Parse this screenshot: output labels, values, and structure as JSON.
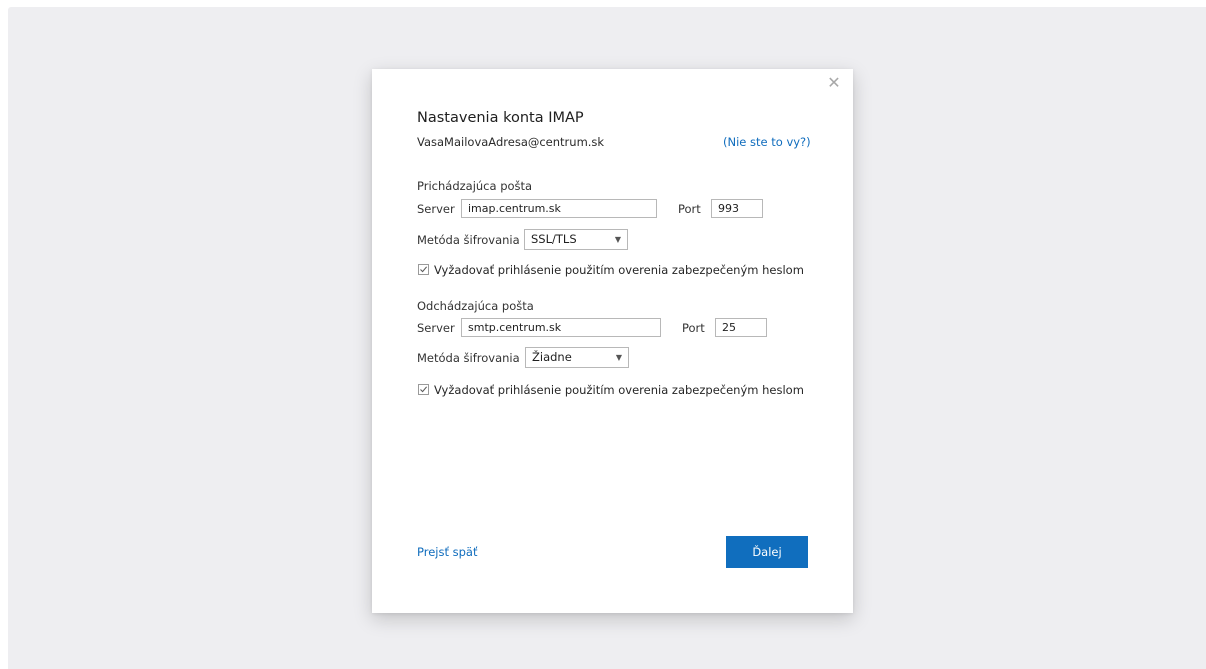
{
  "dialog": {
    "title": "Nastavenia konta IMAP",
    "email": "VasaMailovaAdresa@centrum.sk",
    "not_you_link": "(Nie ste to vy?)",
    "close_glyph": "✕"
  },
  "incoming": {
    "section_label": "Prichádzajúca pošta",
    "server_label": "Server",
    "server_value": "imap.centrum.sk",
    "port_label": "Port",
    "port_value": "993",
    "encryption_label": "Metóda šifrovania",
    "encryption_value": "SSL/TLS",
    "spa_label": "Vyžadovať prihlásenie použitím overenia zabezpečeným heslom",
    "spa_checked": true
  },
  "outgoing": {
    "section_label": "Odchádzajúca pošta",
    "server_label": "Server",
    "server_value": "smtp.centrum.sk",
    "port_label": "Port",
    "port_value": "25",
    "encryption_label": "Metóda šifrovania",
    "encryption_value": "Žiadne",
    "spa_label": "Vyžadovať prihlásenie použitím overenia zabezpečeným heslom",
    "spa_checked": true
  },
  "footer": {
    "back_link": "Prejsť späť",
    "next_button": "Ďalej"
  },
  "colors": {
    "accent": "#106ebe",
    "link": "#0f6cbd",
    "backdrop": "#eeeef1"
  },
  "icons": {
    "close": "close-icon",
    "caret": "chevron-down-icon",
    "check": "checkmark-icon"
  }
}
